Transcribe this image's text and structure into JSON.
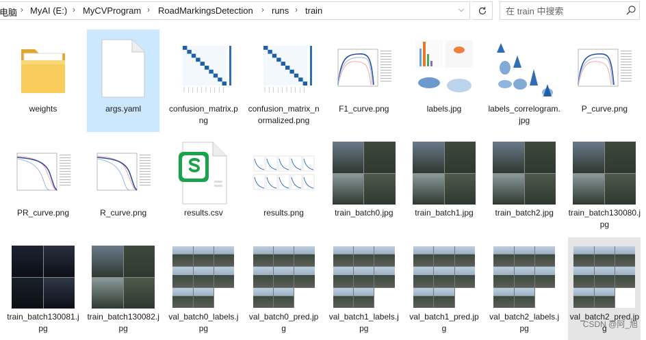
{
  "breadcrumb": {
    "items": [
      "电脑",
      "MyAI (E:)",
      "MyCVProgram",
      "RoadMarkingsDetection",
      "runs",
      "train"
    ]
  },
  "search": {
    "placeholder": "在 train 中搜索"
  },
  "icons": {
    "refresh": "refresh-icon",
    "search": "search-icon",
    "dropdown": "chevron-down-icon",
    "separator": "chevron-right-icon"
  },
  "colors": {
    "selection": "#cce8ff",
    "hover": "#e5e5e5",
    "folder": "#f4c85a",
    "csv_green": "#1aa34a"
  },
  "files": [
    {
      "name": "weights",
      "type": "folder"
    },
    {
      "name": "args.yaml",
      "type": "yaml",
      "selected": true
    },
    {
      "name": "confusion_matrix.png",
      "type": "matrix"
    },
    {
      "name": "confusion_matrix_normalized.png",
      "type": "matrix"
    },
    {
      "name": "F1_curve.png",
      "type": "curve"
    },
    {
      "name": "labels.jpg",
      "type": "labels"
    },
    {
      "name": "labels_correlogram.jpg",
      "type": "correlogram"
    },
    {
      "name": "P_curve.png",
      "type": "curve"
    },
    {
      "name": "PR_curve.png",
      "type": "curve2"
    },
    {
      "name": "R_curve.png",
      "type": "curve2"
    },
    {
      "name": "results.csv",
      "type": "csv"
    },
    {
      "name": "results.png",
      "type": "results"
    },
    {
      "name": "train_batch0.jpg",
      "type": "photo"
    },
    {
      "name": "train_batch1.jpg",
      "type": "photo"
    },
    {
      "name": "train_batch2.jpg",
      "type": "photo"
    },
    {
      "name": "train_batch130080.jpg",
      "type": "photo"
    },
    {
      "name": "train_batch130081.jpg",
      "type": "photo-dark"
    },
    {
      "name": "train_batch130082.jpg",
      "type": "photo"
    },
    {
      "name": "val_batch0_labels.jpg",
      "type": "val"
    },
    {
      "name": "val_batch0_pred.jpg",
      "type": "val"
    },
    {
      "name": "val_batch1_labels.jpg",
      "type": "val"
    },
    {
      "name": "val_batch1_pred.jpg",
      "type": "val"
    },
    {
      "name": "val_batch2_labels.jpg",
      "type": "val"
    },
    {
      "name": "val_batch2_pred.jpg",
      "type": "val",
      "hovered": true
    }
  ],
  "watermark": "CSDN @阿_旭"
}
